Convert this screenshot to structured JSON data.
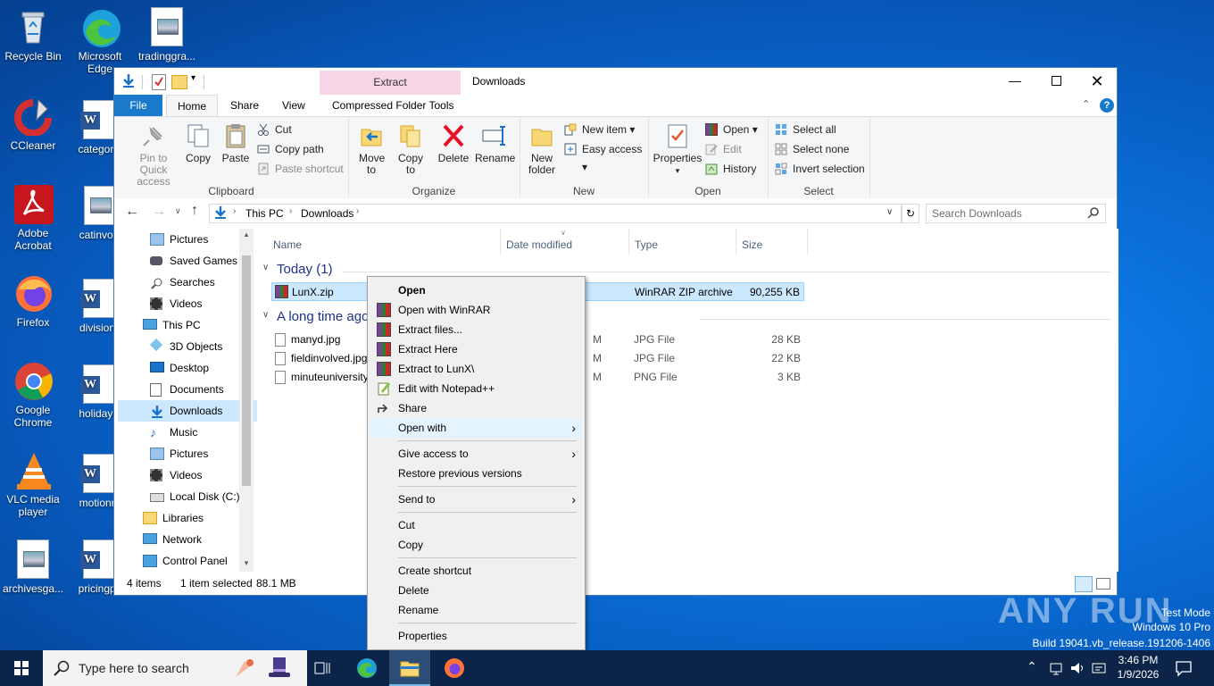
{
  "desktop": {
    "icons": [
      {
        "label": "Recycle Bin"
      },
      {
        "label": "Microsoft Edge"
      },
      {
        "label": "tradinggra..."
      },
      {
        "label": "CCleaner"
      },
      {
        "label": "categorie"
      },
      {
        "label": "Adobe Acrobat"
      },
      {
        "label": "catinvolv"
      },
      {
        "label": "Firefox"
      },
      {
        "label": "divisionc"
      },
      {
        "label": "Google Chrome"
      },
      {
        "label": "holidaylo"
      },
      {
        "label": "VLC media player"
      },
      {
        "label": "motionre"
      },
      {
        "label": "archivesga..."
      },
      {
        "label": "pricingph"
      }
    ]
  },
  "window": {
    "title": "Downloads",
    "context_tab": "Extract",
    "tabs": {
      "file": "File",
      "home": "Home",
      "share": "Share",
      "view": "View",
      "compressed": "Compressed Folder Tools"
    },
    "ribbon": {
      "clipboard": {
        "label": "Clipboard",
        "pin": "Pin to Quick access",
        "copy": "Copy",
        "paste": "Paste",
        "cut": "Cut",
        "copy_path": "Copy path",
        "paste_shortcut": "Paste shortcut"
      },
      "organize": {
        "label": "Organize",
        "move_to": "Move to",
        "copy_to": "Copy to",
        "delete": "Delete",
        "rename": "Rename"
      },
      "new": {
        "label": "New",
        "new_folder": "New folder",
        "new_item": "New item",
        "easy_access": "Easy access"
      },
      "open": {
        "label": "Open",
        "properties": "Properties",
        "open": "Open",
        "edit": "Edit",
        "history": "History"
      },
      "select": {
        "label": "Select",
        "select_all": "Select all",
        "select_none": "Select none",
        "invert": "Invert selection"
      }
    },
    "address": {
      "crumb1": "This PC",
      "crumb2": "Downloads",
      "search_placeholder": "Search Downloads"
    },
    "nav": [
      {
        "label": "Pictures"
      },
      {
        "label": "Saved Games"
      },
      {
        "label": "Searches"
      },
      {
        "label": "Videos"
      },
      {
        "label": "This PC"
      },
      {
        "label": "3D Objects"
      },
      {
        "label": "Desktop"
      },
      {
        "label": "Documents"
      },
      {
        "label": "Downloads"
      },
      {
        "label": "Music"
      },
      {
        "label": "Pictures"
      },
      {
        "label": "Videos"
      },
      {
        "label": "Local Disk (C:)"
      },
      {
        "label": "Libraries"
      },
      {
        "label": "Network"
      },
      {
        "label": "Control Panel"
      }
    ],
    "columns": {
      "name": "Name",
      "date": "Date modified",
      "type": "Type",
      "size": "Size"
    },
    "groups": {
      "today": "Today (1)",
      "longago": "A long time ago"
    },
    "files": [
      {
        "name": "LunX.zip",
        "date": "",
        "type": "WinRAR ZIP archive",
        "size": "90,255 KB"
      },
      {
        "name": "manyd.jpg",
        "date": "M",
        "type": "JPG File",
        "size": "28 KB"
      },
      {
        "name": "fieldinvolved.jpg",
        "date": "M",
        "type": "JPG File",
        "size": "22 KB"
      },
      {
        "name": "minuteuniversity",
        "date": "M",
        "type": "PNG File",
        "size": "3 KB"
      }
    ],
    "status": {
      "count": "4 items",
      "selected": "1 item selected",
      "size": "88.1 MB"
    }
  },
  "context_menu": {
    "items": [
      {
        "label": "Open"
      },
      {
        "label": "Open with WinRAR"
      },
      {
        "label": "Extract files..."
      },
      {
        "label": "Extract Here"
      },
      {
        "label": "Extract to LunX\\"
      },
      {
        "label": "Edit with Notepad++"
      },
      {
        "label": "Share"
      },
      {
        "label": "Open with"
      },
      {
        "label": "Give access to"
      },
      {
        "label": "Restore previous versions"
      },
      {
        "label": "Send to"
      },
      {
        "label": "Cut"
      },
      {
        "label": "Copy"
      },
      {
        "label": "Create shortcut"
      },
      {
        "label": "Delete"
      },
      {
        "label": "Rename"
      },
      {
        "label": "Properties"
      }
    ]
  },
  "taskbar": {
    "search_placeholder": "Type here to search",
    "time": "3:46 PM",
    "date": "1/9/2026"
  },
  "watermark": {
    "mode": "Test Mode",
    "os": "Windows 10 Pro",
    "build": "Build 19041.vb_release.191206-1406",
    "brand": "ANY RUN"
  },
  "colors": {
    "accent": "#0078d7",
    "selection": "#cce8ff",
    "ribbon": "#f5f6f7",
    "taskbar": "#0b2447",
    "extract_tab": "#f7d4e6"
  }
}
